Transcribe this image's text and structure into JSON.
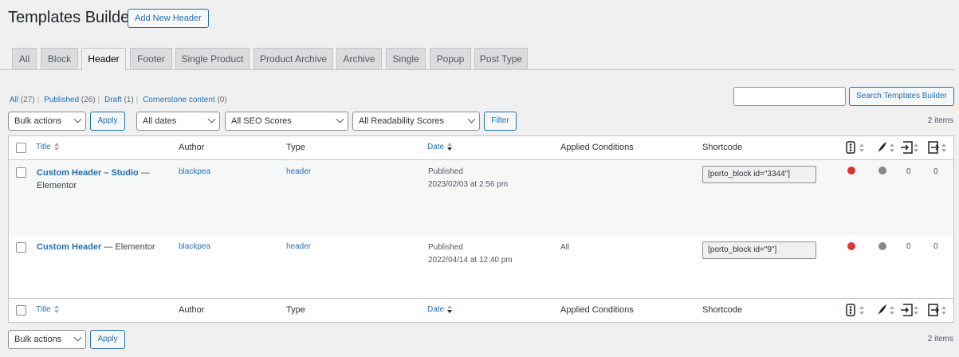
{
  "page": {
    "title": "Templates Builder",
    "add_new": "Add New Header"
  },
  "tabs": [
    "All",
    "Block",
    "Header",
    "Footer",
    "Single Product",
    "Product Archive",
    "Archive",
    "Single",
    "Popup",
    "Post Type"
  ],
  "active_tab": "Header",
  "filters": {
    "all": "All",
    "all_count": "(27)",
    "published": "Published",
    "published_count": "(26)",
    "draft": "Draft",
    "draft_count": "(1)",
    "cornerstone": "Cornerstone content",
    "cornerstone_count": "(0)"
  },
  "search": {
    "button": "Search Templates Builder",
    "value": ""
  },
  "toolbar": {
    "bulk": "Bulk actions",
    "apply": "Apply",
    "dates": "All dates",
    "seo": "All SEO Scores",
    "readability": "All Readability Scores",
    "filter": "Filter",
    "count": "2 items"
  },
  "columns": {
    "title": "Title",
    "author": "Author",
    "type": "Type",
    "date": "Date",
    "conditions": "Applied Conditions",
    "shortcode": "Shortcode"
  },
  "rows": [
    {
      "title": "Custom Header – Studio",
      "suffix": " —",
      "suffix2": "Elementor",
      "author": "blackpea",
      "type": "header",
      "status": "Published",
      "date": "2023/02/03 at 2:56 pm",
      "conditions": "",
      "shortcode": "[porto_block id=\"3344\"]",
      "links_out": "0",
      "links_in": "0"
    },
    {
      "title": "Custom Header",
      "suffix": " — Elementor",
      "suffix2": "",
      "author": "blackpea",
      "type": "header",
      "status": "Published",
      "date": "2022/04/14 at 12:40 pm",
      "conditions": "All",
      "shortcode": "[porto_block id=\"9\"]",
      "links_out": "0",
      "links_in": "0"
    }
  ],
  "colors": {
    "seo_bad": "#d63638",
    "readability_na": "#888888",
    "accent": "#2271b1"
  },
  "icons": [
    "seo-score-icon",
    "readability-icon",
    "outgoing-links-icon",
    "incoming-links-icon"
  ]
}
